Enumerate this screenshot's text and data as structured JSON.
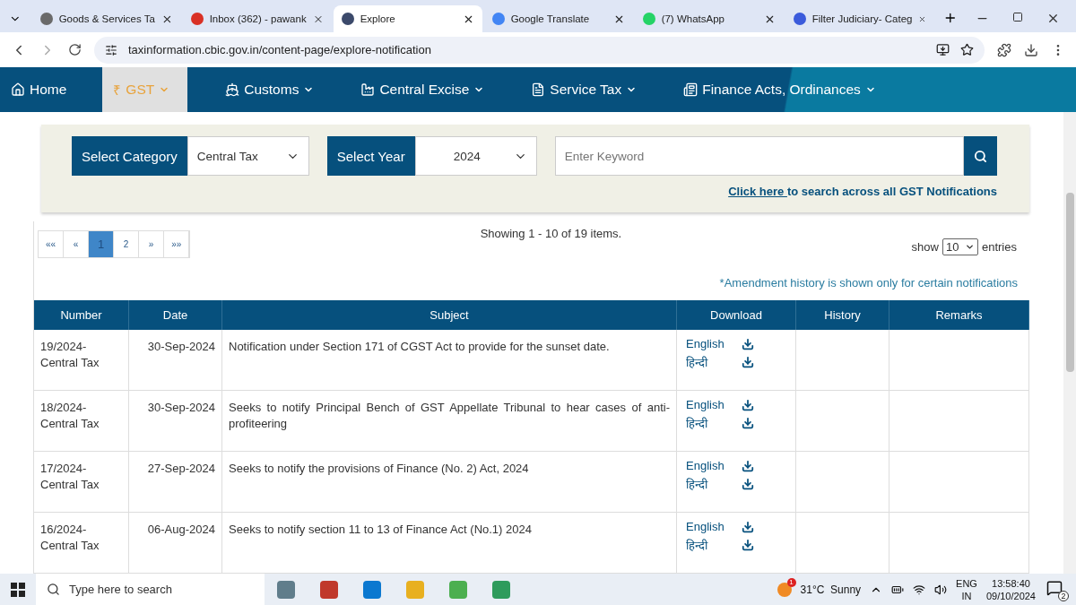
{
  "browser": {
    "tabs": [
      {
        "label": "Goods & Services Ta",
        "selected": false
      },
      {
        "label": "Inbox (362) - pawank",
        "selected": false
      },
      {
        "label": "Explore",
        "selected": true
      },
      {
        "label": "Google Translate",
        "selected": false
      },
      {
        "label": "(7) WhatsApp",
        "selected": false
      },
      {
        "label": "Filter Judiciary- Categ",
        "selected": false
      }
    ],
    "url": "taxinformation.cbic.gov.in/content-page/explore-notification"
  },
  "nav": [
    {
      "label": "Home",
      "selected": false,
      "dropdown": false
    },
    {
      "label": "GST",
      "selected": true,
      "dropdown": true,
      "symbol": "₹"
    },
    {
      "label": "Customs",
      "selected": false,
      "dropdown": true
    },
    {
      "label": "Central Excise",
      "selected": false,
      "dropdown": true
    },
    {
      "label": "Service Tax",
      "selected": false,
      "dropdown": true
    },
    {
      "label": "Finance Acts, Ordinances",
      "selected": false,
      "dropdown": true
    }
  ],
  "filters": {
    "category_label": "Select Category",
    "category": "Central Tax",
    "year_label": "Select Year",
    "year": "2024",
    "keyword_placeholder": "Enter Keyword",
    "link": "Click here ",
    "link_rest": "to search across all GST Notifications"
  },
  "pagination": [
    {
      "label": "««",
      "selected": false
    },
    {
      "label": "«",
      "selected": false
    },
    {
      "label": "1",
      "selected": true
    },
    {
      "label": "2",
      "selected": false
    },
    {
      "label": "»",
      "selected": false
    },
    {
      "label": "»»",
      "selected": false
    }
  ],
  "showing": "Showing 1 - 10 of 19 items.",
  "show_label": "show",
  "page_size": "10",
  "entries_label": "entries",
  "note": "*Amendment history is shown only for certain notifications",
  "table": {
    "columns": [
      "Number",
      "Date",
      "Subject",
      "Download",
      "History",
      "Remarks"
    ],
    "rows": [
      {
        "number": "19/2024-Central Tax",
        "date": "30-Sep-2024",
        "subject": "Notification under Section 171 of CGST Act to provide for the sunset date.",
        "downloads": [
          "English",
          "हिन्दी"
        ]
      },
      {
        "number": "18/2024-Central Tax",
        "date": "30-Sep-2024",
        "subject": "Seeks to notify Principal Bench of GST Appellate Tribunal to hear cases of anti-profiteering",
        "downloads": [
          "English",
          "हिन्दी"
        ]
      },
      {
        "number": "17/2024-Central Tax",
        "date": "27-Sep-2024",
        "subject": "Seeks to notify the provisions of Finance (No. 2) Act, 2024",
        "downloads": [
          "English",
          "हिन्दी"
        ]
      },
      {
        "number": "16/2024-Central Tax",
        "date": "06-Aug-2024",
        "subject": "Seeks to notify section 11 to 13 of Finance Act (No.1) 2024",
        "downloads": [
          "English",
          "हिन्दी"
        ]
      }
    ]
  },
  "taskbar": {
    "search_placeholder": "Type here to search",
    "weather": "31°C  Sunny",
    "weather_badge": "1",
    "language": "ENG",
    "region": "IN",
    "time": "13:58:40",
    "date": "09/10/2024",
    "notifications": "2"
  }
}
